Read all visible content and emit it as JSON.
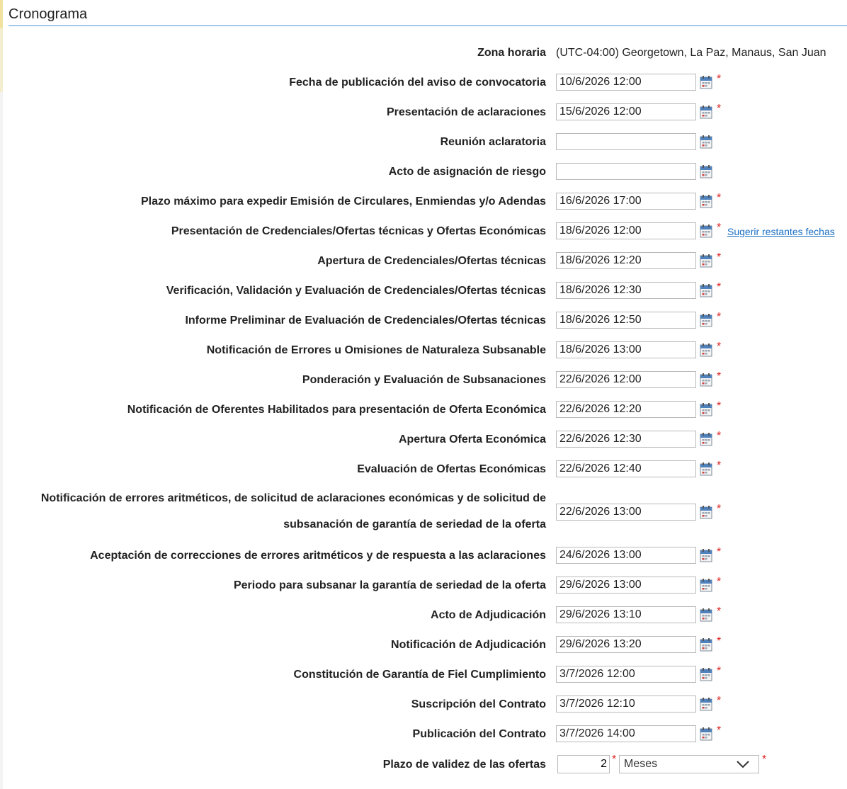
{
  "section": {
    "title": "Cronograma"
  },
  "timezone": {
    "label": "Zona horaria",
    "value": "(UTC-04:00) Georgetown, La Paz, Manaus, San Juan"
  },
  "rows": [
    {
      "label": "Fecha de publicación del aviso de convocatoria",
      "value": "10/6/2026 12:00",
      "required": true
    },
    {
      "label": "Presentación de aclaraciones",
      "value": "15/6/2026 12:00",
      "required": true
    },
    {
      "label": "Reunión aclaratoria",
      "value": "",
      "required": false
    },
    {
      "label": "Acto de asignación de riesgo",
      "value": "",
      "required": false
    },
    {
      "label": "Plazo máximo para expedir Emisión de Circulares, Enmiendas y/o Adendas",
      "value": "16/6/2026 17:00",
      "required": true
    },
    {
      "label": "Presentación de Credenciales/Ofertas técnicas y Ofertas Económicas",
      "value": "18/6/2026 12:00",
      "required": true,
      "link": "Sugerir restantes fechas"
    },
    {
      "label": "Apertura de Credenciales/Ofertas técnicas",
      "value": "18/6/2026 12:20",
      "required": true
    },
    {
      "label": "Verificación, Validación y Evaluación de Credenciales/Ofertas técnicas",
      "value": "18/6/2026 12:30",
      "required": true
    },
    {
      "label": "Informe Preliminar de Evaluación de Credenciales/Ofertas técnicas",
      "value": "18/6/2026 12:50",
      "required": true
    },
    {
      "label": "Notificación de Errores u Omisiones de Naturaleza Subsanable",
      "value": "18/6/2026 13:00",
      "required": true
    },
    {
      "label": "Ponderación y Evaluación de Subsanaciones",
      "value": "22/6/2026 12:00",
      "required": true
    },
    {
      "label": "Notificación de Oferentes Habilitados para presentación de Oferta Económica",
      "value": "22/6/2026 12:20",
      "required": true
    },
    {
      "label": "Apertura Oferta Económica",
      "value": "22/6/2026 12:30",
      "required": true
    },
    {
      "label": "Evaluación de Ofertas Económicas",
      "value": "22/6/2026 12:40",
      "required": true
    },
    {
      "label": "Notificación de errores aritméticos, de solicitud de aclaraciones económicas y de solicitud de subsanación de garantía de seriedad de la oferta",
      "value": "22/6/2026 13:00",
      "required": true
    },
    {
      "label": "Aceptación de correcciones de errores aritméticos y de respuesta a las aclaraciones",
      "value": "24/6/2026 13:00",
      "required": true
    },
    {
      "label": "Periodo para subsanar la garantía de seriedad de la oferta",
      "value": "29/6/2026 13:00",
      "required": true
    },
    {
      "label": "Acto de Adjudicación",
      "value": "29/6/2026 13:10",
      "required": true
    },
    {
      "label": "Notificación de Adjudicación",
      "value": "29/6/2026 13:20",
      "required": true
    },
    {
      "label": "Constitución de Garantía de Fiel Cumplimiento",
      "value": "3/7/2026 12:00",
      "required": true
    },
    {
      "label": "Suscripción del Contrato",
      "value": "3/7/2026 12:10",
      "required": true
    },
    {
      "label": "Publicación del Contrato",
      "value": "3/7/2026 14:00",
      "required": true
    }
  ],
  "validity": {
    "label": "Plazo de validez de las ofertas",
    "number": "2",
    "unit": "Meses"
  },
  "icons": {
    "calendar": "calendar-icon",
    "dropdown": "chevron-down-icon"
  },
  "colors": {
    "accent_line": "#4a90d9",
    "required": "#e02020",
    "link": "#1a6fc4"
  }
}
